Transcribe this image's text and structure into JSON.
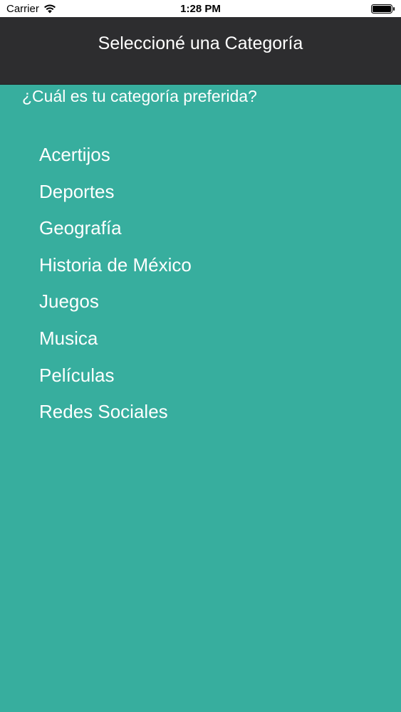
{
  "status_bar": {
    "carrier": "Carrier",
    "time": "1:28 PM"
  },
  "nav": {
    "title": "Seleccioné una Categoría"
  },
  "main": {
    "question": "¿Cuál es tu categoría preferida?",
    "categories": [
      "Acertijos",
      "Deportes",
      "Geografía",
      "Historia de México",
      "Juegos",
      "Musica",
      "Películas",
      "Redes Sociales"
    ]
  },
  "colors": {
    "background": "#37ae9e",
    "nav_background": "#2d2d2f",
    "text": "#ffffff"
  }
}
